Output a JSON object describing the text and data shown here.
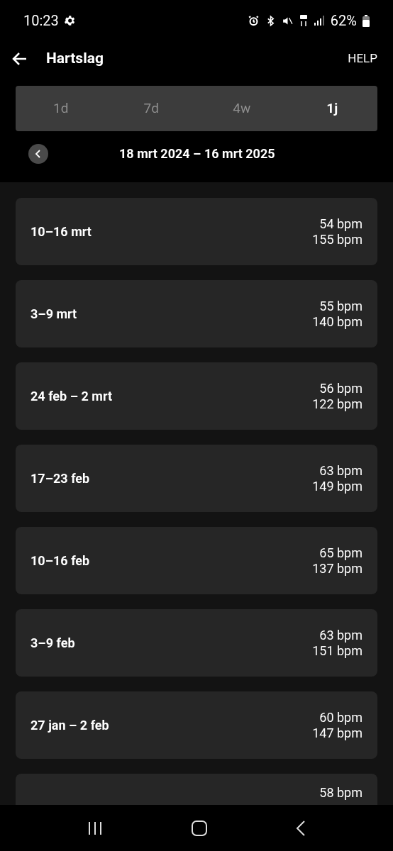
{
  "status_bar": {
    "time": "10:23",
    "battery": "62%"
  },
  "header": {
    "title": "Hartslag",
    "action": "HELP"
  },
  "tabs": [
    {
      "label": "1d",
      "selected": false
    },
    {
      "label": "7d",
      "selected": false
    },
    {
      "label": "4w",
      "selected": false
    },
    {
      "label": "1j",
      "selected": true
    }
  ],
  "range": "18 mrt 2024 – 16 mrt 2025",
  "weeks": [
    {
      "label": "10–16 mrt",
      "min": "54 bpm",
      "max": "155 bpm"
    },
    {
      "label": "3–9 mrt",
      "min": "55 bpm",
      "max": "140 bpm"
    },
    {
      "label": "24 feb – 2 mrt",
      "min": "56 bpm",
      "max": "122 bpm"
    },
    {
      "label": "17–23 feb",
      "min": "63 bpm",
      "max": "149 bpm"
    },
    {
      "label": "10–16 feb",
      "min": "65 bpm",
      "max": "137 bpm"
    },
    {
      "label": "3–9 feb",
      "min": "63 bpm",
      "max": "151 bpm"
    },
    {
      "label": "27 jan – 2 feb",
      "min": "60 bpm",
      "max": "147 bpm"
    },
    {
      "min": "58 bpm"
    }
  ]
}
